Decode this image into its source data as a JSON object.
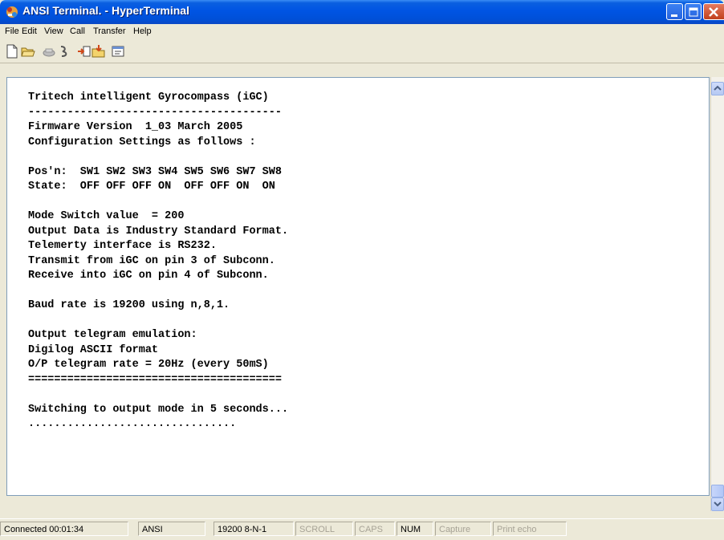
{
  "window": {
    "title": "ANSI Terminal. - HyperTerminal"
  },
  "menu": [
    "File",
    "Edit",
    "View",
    "Call",
    "Transfer",
    "Help"
  ],
  "toolbar": {
    "icons": [
      "new-file-icon",
      "open-folder-icon",
      "phone-icon",
      "disconnect-icon",
      "send-file-icon",
      "receive-file-icon",
      "properties-icon"
    ]
  },
  "terminal": {
    "lines": [
      "Tritech intelligent Gyrocompass (iGC)",
      "---------------------------------------",
      "Firmware Version  1_03 March 2005",
      "Configuration Settings as follows :",
      "",
      "Pos'n:  SW1 SW2 SW3 SW4 SW5 SW6 SW7 SW8",
      "State:  OFF OFF OFF ON  OFF OFF ON  ON",
      "",
      "Mode Switch value  = 200",
      "Output Data is Industry Standard Format.",
      "Telemerty interface is RS232.",
      "Transmit from iGC on pin 3 of Subconn.",
      "Receive into iGC on pin 4 of Subconn.",
      "",
      "Baud rate is 19200 using n,8,1.",
      "",
      "Output telegram emulation:",
      "Digilog ASCII format",
      "O/P telegram rate = 20Hz (every 50mS)",
      "=======================================",
      "",
      "Switching to output mode in 5 seconds...",
      "................................"
    ]
  },
  "status": {
    "connected": "Connected 00:01:34",
    "emulation": "ANSI",
    "settings": "19200 8-N-1",
    "scroll": "SCROLL",
    "caps": "CAPS",
    "num": "NUM",
    "capture": "Capture",
    "print_echo": "Print echo"
  }
}
